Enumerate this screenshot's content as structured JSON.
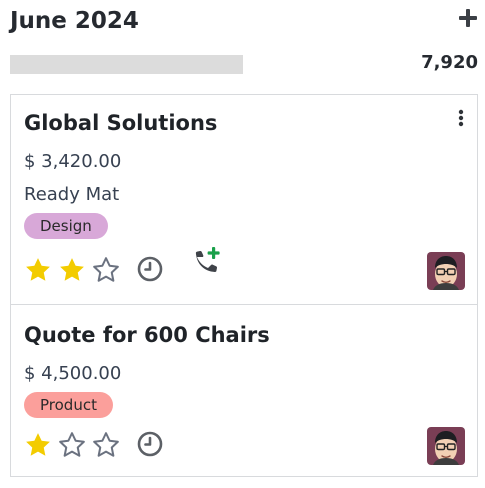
{
  "column": {
    "title": "June 2024",
    "total": "7,920",
    "progress_fraction": 0
  },
  "cards": [
    {
      "name": "Global Solutions",
      "amount": "$ 3,420.00",
      "company": "Ready Mat",
      "tag": {
        "label": "Design",
        "color": "#d8a8d8"
      },
      "rating": 2,
      "max_rating": 3,
      "activity_icon": "clock-icon",
      "extra_icon": "phone-plus-icon",
      "avatar": "user-avatar"
    },
    {
      "name": "Quote for 600 Chairs",
      "amount": "$ 4,500.00",
      "tag": {
        "label": "Product",
        "color": "#fb9f9b"
      },
      "rating": 1,
      "max_rating": 3,
      "activity_icon": "clock-icon",
      "avatar": "user-avatar"
    }
  ],
  "colors": {
    "star_filled": "#f3cc00",
    "star_empty": "#6b7280",
    "icon_gray": "#5c6066",
    "plus_green": "#1aa04a"
  }
}
